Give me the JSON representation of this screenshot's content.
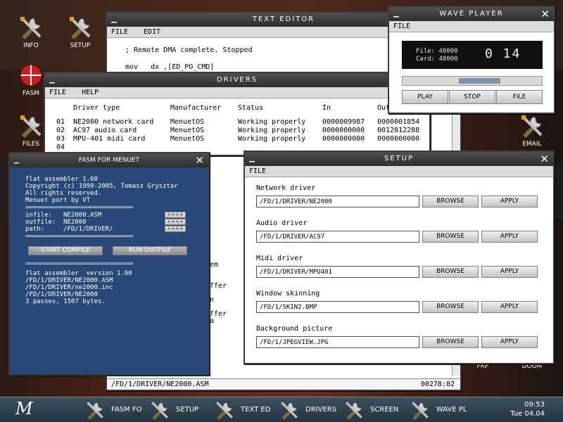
{
  "colors": {
    "fasm_bg": "#284878",
    "wave_display": "#101010",
    "taskbar": "#2e404c"
  },
  "desktop": {
    "icons": [
      {
        "label": "INFO",
        "icon": "tools-icon"
      },
      {
        "label": "SETUP",
        "icon": "tools-icon"
      },
      {
        "label": "FASM",
        "icon": "fasm-icon"
      },
      {
        "label": "FILES",
        "icon": "tools-icon"
      },
      {
        "label": "EMAIL",
        "icon": "tools-icon"
      },
      {
        "label": "FRP",
        "icon": "tools-icon"
      },
      {
        "label": "DOOM",
        "icon": "tools-icon"
      }
    ]
  },
  "text_editor": {
    "title": "TEXT EDITOR",
    "menu": [
      "FILE",
      "EDIT"
    ],
    "lines": [
      "; Remote DMA complete. Stopped",
      "",
      "mov   dx ,[ED_PO_CMD]"
    ],
    "frag_lines": [
      "em",
      "",
      "",
      "ffer",
      "",
      "n",
      "",
      "ffer",
      "a"
    ],
    "status_path": "/FD/1/DRIVER/NE2000.ASM",
    "status_pos": "00278:02"
  },
  "drivers": {
    "title": "DRIVERS",
    "menu": [
      "FILE",
      "HELP"
    ],
    "headers": [
      "Driver type",
      "Manufacturer",
      "Status",
      "In",
      "Out"
    ],
    "rows": [
      {
        "num": "01",
        "type": "NE2000 network card",
        "mfr": "MenuetOS",
        "status": "Working properly",
        "in": "0000009987",
        "out": "0000001854"
      },
      {
        "num": "02",
        "type": "AC97 audio card",
        "mfr": "MenuetOS",
        "status": "Working properly",
        "in": "0000000000",
        "out": "0012812288"
      },
      {
        "num": "03",
        "type": "MPU-401 midi card",
        "mfr": "MenuetOS",
        "status": "Working properly",
        "in": "0000000000",
        "out": "0000000000"
      },
      {
        "num": "04",
        "type": "",
        "mfr": "",
        "status": "",
        "in": "",
        "out": ""
      }
    ]
  },
  "wave_player": {
    "title": "WAVE PLAYER",
    "menu": [
      "FILE"
    ],
    "file_label": "File:",
    "file_value": "48000",
    "card_label": "Card:",
    "card_value": "48000",
    "counter": "0 14",
    "progress": 0.55,
    "buttons": [
      "PLAY",
      "STOP",
      "FILE"
    ]
  },
  "fasm": {
    "title": "FASM FOR MENUET",
    "header_lines": [
      "flat assembler 1.60",
      "Copyright (c) 1999-2005, Tomasz Grysztar",
      "All rights reserved.",
      "Menuet port by VT",
      "========================================"
    ],
    "infile_label": "infile:",
    "infile_value": "NE2000.ASM",
    "outfile_label": "outfile:",
    "outfile_value": "NE2000",
    "path_label": "path:",
    "path_value": "/FD/1/DRIVER/",
    "arrow_label": "<<<<",
    "separator": "========================================",
    "start_button": "START COMPILE",
    "run_button": "RUN OUTFILE",
    "output_lines": [
      "flat assembler  version 1.60",
      "/FD/1/DRIVER/NE2000.ASM",
      "/FD/1/DRIVER/ne2000.inc",
      "/FD/1/DRIVER/NE2000",
      "3 passes, 1507 bytes."
    ]
  },
  "setup": {
    "title": "SETUP",
    "menu": [
      "FILE"
    ],
    "browse_label": "BROWSE",
    "apply_label": "APPLY",
    "groups": [
      {
        "label": "Network driver",
        "value": "/FD/1/DRIVER/NE2000"
      },
      {
        "label": "Audio driver",
        "value": "/FD/1/DRIVER/AC97"
      },
      {
        "label": "Midi driver",
        "value": "/FD/1/DRIVER/MPU401"
      },
      {
        "label": "Window skinning",
        "value": "/FD/1/SKIN2.BMP"
      },
      {
        "label": "Background picture",
        "value": "/FD/1/JPEGVIEW.JPG"
      }
    ]
  },
  "taskbar": {
    "logo": "M",
    "items": [
      "FASM FO",
      "SETUP",
      "TEXT ED",
      "DRIVERS",
      "SCREEN",
      "WAVE PL"
    ],
    "time": "09:53",
    "date": "Tue 04.04"
  }
}
